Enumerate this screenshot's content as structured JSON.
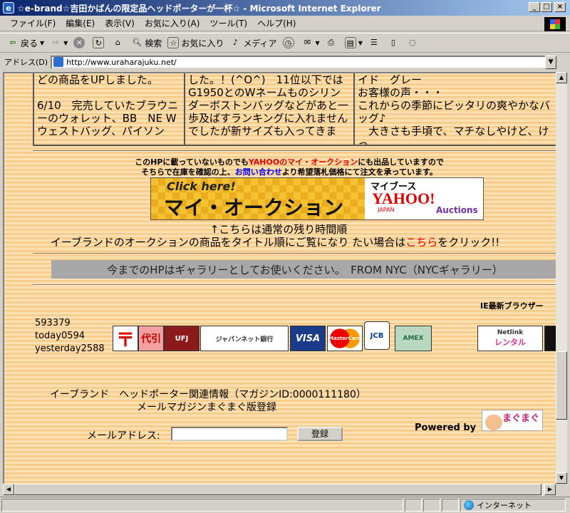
{
  "window": {
    "title": "☆e-brand☆吉田かばんの限定品ヘッドポーターが一杯☆ - Microsoft Internet Explorer",
    "min": "_",
    "max": "□",
    "close": "×"
  },
  "menu": [
    "ファイル(F)",
    "編集(E)",
    "表示(V)",
    "お気に入り(A)",
    "ツール(T)",
    "ヘルプ(H)"
  ],
  "toolbar": {
    "back": "戻る",
    "search": "検索",
    "favorites": "お気に入り",
    "media": "メディア"
  },
  "address": {
    "label": "アドレス(D)",
    "url": "http://www.uraharajuku.net/"
  },
  "page": {
    "columns": [
      {
        "text": "どの商品をUPしました。\n\n6/10　完売していたブラウニーのウォレット、BB　NE Wウェストバッグ、パイソン"
      },
      {
        "text": "した。！(^O^)　11位以下ではG1950とのWネームものシリンダーボストンバッグなどがあと一歩及ばすランキングに入れませんでしたが新サイズも入ってきま"
      },
      {
        "text": "イド　グレー\nお客様の声・・・\nこれからの季節にピッタリの爽やかなバッグ♪\n　大きさも手頃で、マチなしやけど、けっ"
      }
    ],
    "auction_note_pre": "このHPに載っていないものでも",
    "auction_note_red": "YAHOOのマイ・オークション",
    "auction_note_post": "にも出品していますので",
    "auction_note2_pre": "そちらで在庫を確認の上、",
    "auction_note2_blue": "お問い合わせ",
    "auction_note2_post": "より希望落札価格にて注文を承っています。",
    "banner": {
      "click": "Click here!",
      "main": "マイ・オークション",
      "mybooth": "マイブース",
      "yahoo": "YAHOO!",
      "japan": "JAPAN",
      "auctions": "Auctions"
    },
    "remaining_time": "↑こちらは通常の残り時間順",
    "title_order_pre": "イーブランドのオークションの商品をタイトル順にご覧になり たい場合は",
    "title_order_link": "こちら",
    "title_order_post": "をクリック!!",
    "gallery": "今までのHPはギャラリーとしてお使いください。　FROM NYC（NYCギャラリー）",
    "ie_note": "IE最新ブラウザー",
    "counter": {
      "total": "593379",
      "today": "today0594",
      "yesterday": "yesterday2588"
    },
    "payment_logos": {
      "post": "〒",
      "daibiki": "代引",
      "ufj": "UFJ",
      "japannet": "ジャパンネット銀行",
      "visa": "VISA",
      "master": "MasterCard",
      "jcb": "JCB",
      "amex": "AMEX",
      "netlink": "Netlink",
      "rental": "レンタル"
    },
    "magazine": {
      "line1": "イーブランド　ヘッドポーター関連情報（マガジンID:0000111180）",
      "line2": "メールマガジンまぐまぐ版登録",
      "label": "メールアドレス:",
      "input_value": "",
      "button": "登録",
      "powered": "Powered by",
      "mag_logo": "まぐまぐ"
    }
  },
  "status": {
    "zone": "インターネット"
  },
  "colors": {
    "titlebar": "#0a246a",
    "page_bg": "#fbd7a2",
    "red_text": "#e00000",
    "link_blue": "#0000ee"
  }
}
